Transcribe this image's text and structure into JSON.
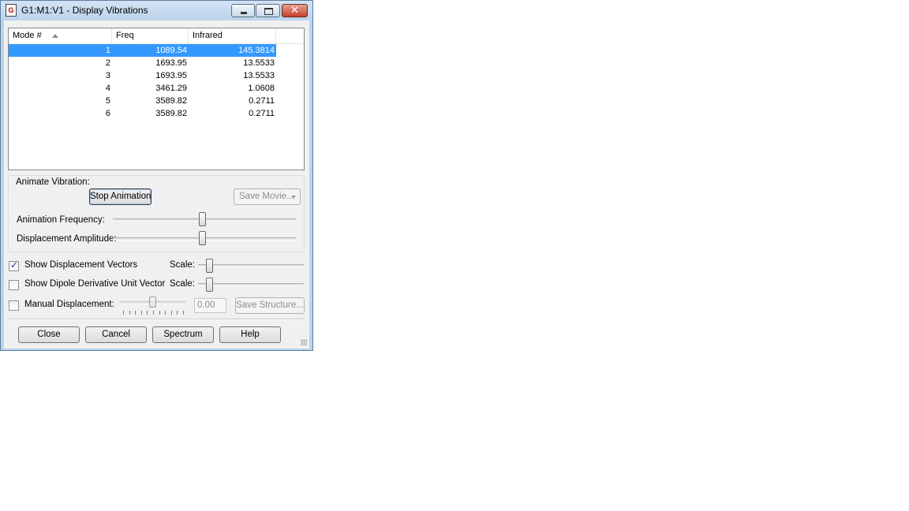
{
  "window": {
    "title": "G1:M1:V1 - Display Vibrations",
    "icon": "document-icon",
    "close_glyph": "✕"
  },
  "table": {
    "columns": [
      "Mode #",
      "Freq",
      "Infrared"
    ],
    "rows": [
      {
        "mode": "1",
        "freq": "1089.54",
        "ir": "145.3814",
        "selected": true
      },
      {
        "mode": "2",
        "freq": "1693.95",
        "ir": "13.5533",
        "selected": false
      },
      {
        "mode": "3",
        "freq": "1693.95",
        "ir": "13.5533",
        "selected": false
      },
      {
        "mode": "4",
        "freq": "3461.29",
        "ir": "1.0608",
        "selected": false
      },
      {
        "mode": "5",
        "freq": "3589.82",
        "ir": "0.2711",
        "selected": false
      },
      {
        "mode": "6",
        "freq": "3589.82",
        "ir": "0.2711",
        "selected": false
      }
    ]
  },
  "animate": {
    "group_label": "Animate Vibration:",
    "stop_label": "Stop Animation",
    "save_movie_label": "Save Movie...",
    "freq_label": "Animation Frequency:",
    "freq_level": 0.49,
    "amp_label": "Displacement Amplitude:",
    "amp_level": 0.49
  },
  "options": {
    "show_vectors_label": "Show Displacement Vectors",
    "show_vectors_checked": true,
    "vectors_scale_label": "Scale:",
    "vectors_scale_level": 0.08,
    "show_dipole_label": "Show Dipole Derivative Unit Vector",
    "show_dipole_checked": false,
    "dipole_scale_label": "Scale:",
    "dipole_scale_level": 0.08,
    "manual_label": "Manual Displacement:",
    "manual_checked": false,
    "manual_level": 0.5,
    "manual_value": "0.00",
    "save_structure_label": "Save Structure..."
  },
  "buttons": {
    "close": "Close",
    "cancel": "Cancel",
    "spectrum": "Spectrum",
    "help": "Help"
  }
}
